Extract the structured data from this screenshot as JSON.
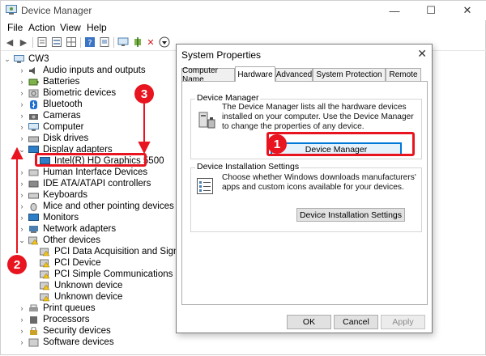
{
  "window": {
    "title": "Device Manager",
    "minimize": "—",
    "maximize": "☐",
    "close": "✕"
  },
  "menu": [
    "File",
    "Action",
    "View",
    "Help"
  ],
  "tree": {
    "root": "CW3",
    "items": [
      "Audio inputs and outputs",
      "Batteries",
      "Biometric devices",
      "Bluetooth",
      "Cameras",
      "Computer",
      "Disk drives",
      "Display adapters",
      "Intel(R) HD Graphics 5500",
      "Human Interface Devices",
      "IDE ATA/ATAPI controllers",
      "Keyboards",
      "Mice and other pointing devices",
      "Monitors",
      "Network adapters",
      "Other devices",
      "PCI Data Acquisition and Signal Processing Controller",
      "PCI Device",
      "PCI Simple Communications Controller",
      "Unknown device",
      "Unknown device",
      "Print queues",
      "Processors",
      "Security devices",
      "Software devices"
    ]
  },
  "dialog": {
    "title": "System Properties",
    "close": "✕",
    "tabs": [
      "Computer Name",
      "Hardware",
      "Advanced",
      "System Protection",
      "Remote"
    ],
    "device_manager": {
      "label": "Device Manager",
      "description": "The Device Manager lists all the hardware devices installed on your computer. Use the Device Manager to change the properties of any device.",
      "button": "Device Manager"
    },
    "install_settings": {
      "label": "Device Installation Settings",
      "description": "Choose whether Windows downloads manufacturers' apps and custom icons available for your devices.",
      "button": "Device Installation Settings"
    },
    "ok": "OK",
    "cancel": "Cancel",
    "apply": "Apply"
  },
  "annotations": {
    "step1": "1",
    "step2": "2",
    "step3": "3",
    "color": "#e8141f"
  }
}
